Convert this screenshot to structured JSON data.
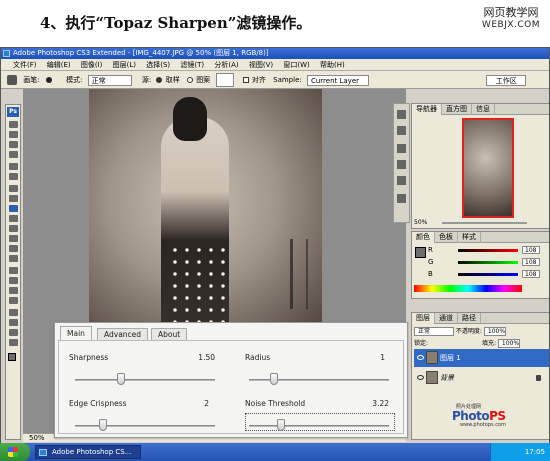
{
  "tutorial": {
    "heading": "4、执行“Topaz Sharpen”滤镜操作。",
    "watermark_cn": "网页教学网",
    "watermark_url": "WEBJX.COM"
  },
  "window": {
    "title": "Adobe Photoshop CS3 Extended - [IMG_4407.JPG @ 50% (图层 1, RGB/8)]"
  },
  "menu": [
    "文件(F)",
    "编辑(E)",
    "图像(I)",
    "图层(L)",
    "选择(S)",
    "滤镜(T)",
    "分析(A)",
    "视图(V)",
    "窗口(W)",
    "帮助(H)"
  ],
  "options_bar": {
    "brush_label": "画笔:",
    "mode_label": "模式:",
    "mode_value": "正常",
    "source_label": "源:",
    "sample_option": "取样",
    "pattern_option": "图案",
    "aligned_label": "对齐",
    "sample_label": "Sample:",
    "sample_value": "Current Layer",
    "workspace_label": "工作区"
  },
  "canvas": {
    "zoom": "50%"
  },
  "panels": {
    "navigator_tabs": [
      "导航器",
      "直方图",
      "信息"
    ],
    "navigator_zoom": "50%",
    "color_tabs": [
      "颜色",
      "色板",
      "样式"
    ],
    "color_channels": [
      {
        "label": "R",
        "value": "108"
      },
      {
        "label": "G",
        "value": "108"
      },
      {
        "label": "B",
        "value": "108"
      }
    ],
    "layers_tabs": [
      "图层",
      "通道",
      "路径"
    ],
    "blend_mode": "正常",
    "opacity_label": "不透明度:",
    "opacity_value": "100%",
    "lock_label": "锁定:",
    "fill_label": "填充:",
    "fill_value": "100%",
    "layers": [
      {
        "name": "图层 1",
        "selected": true
      },
      {
        "name": "背景",
        "selected": false
      }
    ],
    "logo_cn": "照片处理网",
    "logo_photo": "Photo",
    "logo_ps": "PS",
    "logo_url": "www.photops.com"
  },
  "topaz_dialog": {
    "tabs": [
      "Main",
      "Advanced",
      "About"
    ],
    "active_tab": "Main",
    "params": {
      "sharpness": {
        "label": "Sharpness",
        "value": "1.50",
        "level": 0.33
      },
      "radius": {
        "label": "Radius",
        "value": "1",
        "level": 0.18
      },
      "edge_crispness": {
        "label": "Edge Crispness",
        "value": "2",
        "level": 0.2
      },
      "noise_threshold": {
        "label": "Noise Threshold",
        "value": "3.22",
        "level": 0.23
      }
    }
  },
  "taskbar": {
    "task_label": "Adobe Photoshop CS...",
    "time": "17:05"
  },
  "colors": {
    "titlebar": "#1f4fb8",
    "selection": "#316ac5",
    "taskbar": "#2452b5",
    "start_green": "#2f8a2f",
    "nav_frame": "#dd2222"
  }
}
